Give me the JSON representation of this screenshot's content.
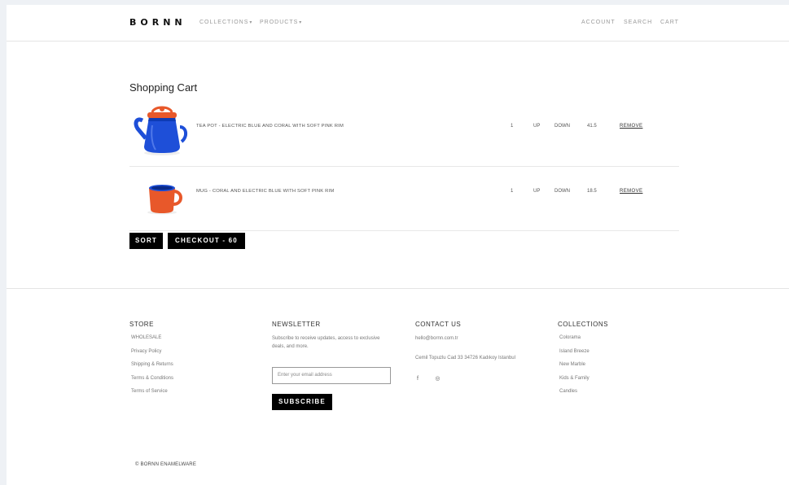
{
  "header": {
    "logo": "BORNN",
    "nav": [
      {
        "label": "COLLECTIONS"
      },
      {
        "label": "PRODUCTS"
      }
    ],
    "caret": "▾",
    "right": [
      {
        "label": "ACCOUNT"
      },
      {
        "label": "SEARCH"
      },
      {
        "label": "CART"
      }
    ]
  },
  "cart": {
    "title": "Shopping Cart",
    "items": [
      {
        "name": "TEA POT - ELECTRIC BLUE AND CORAL WITH SOFT PINK RIM",
        "qty": "1",
        "up": "UP",
        "down": "DOWN",
        "price": "41.5",
        "remove": "REMOVE"
      },
      {
        "name": "MUG - CORAL AND ELECTRIC BLUE WITH SOFT PINK RIM",
        "qty": "1",
        "up": "UP",
        "down": "DOWN",
        "price": "18.5",
        "remove": "REMOVE"
      }
    ],
    "sort_label": "SORT",
    "checkout_label": "CHECKOUT - 60"
  },
  "footer": {
    "store": {
      "title": "STORE",
      "links": [
        "WHOLESALE",
        "Privacy Policy",
        "Shipping & Returns",
        "Terms & Conditions",
        "Terms of Service"
      ]
    },
    "newsletter": {
      "title": "NEWSLETTER",
      "text": "Subscribe to receive updates, access to exclusive deals, and more.",
      "placeholder": "Enter your email address",
      "button": "SUBSCRIBE"
    },
    "contact": {
      "title": "CONTACT US",
      "email": "hello@bornn.com.tr",
      "address": "Cemil Topuzlu Cad 33 34726 Kadıkoy Istanbul",
      "social": [
        {
          "icon": "facebook-icon",
          "glyph": "f"
        },
        {
          "icon": "instagram-icon",
          "glyph": "◎"
        }
      ]
    },
    "collections": {
      "title": "COLLECTIONS",
      "links": [
        "Colorama",
        "Island Breeze",
        "New Marble",
        "Kids & Family",
        "Candles"
      ]
    },
    "copyright": "© BORNN ENAMELWARE"
  },
  "colors": {
    "accent": "#000000",
    "teapot_blue": "#1e4fd8",
    "coral": "#e8582a"
  }
}
